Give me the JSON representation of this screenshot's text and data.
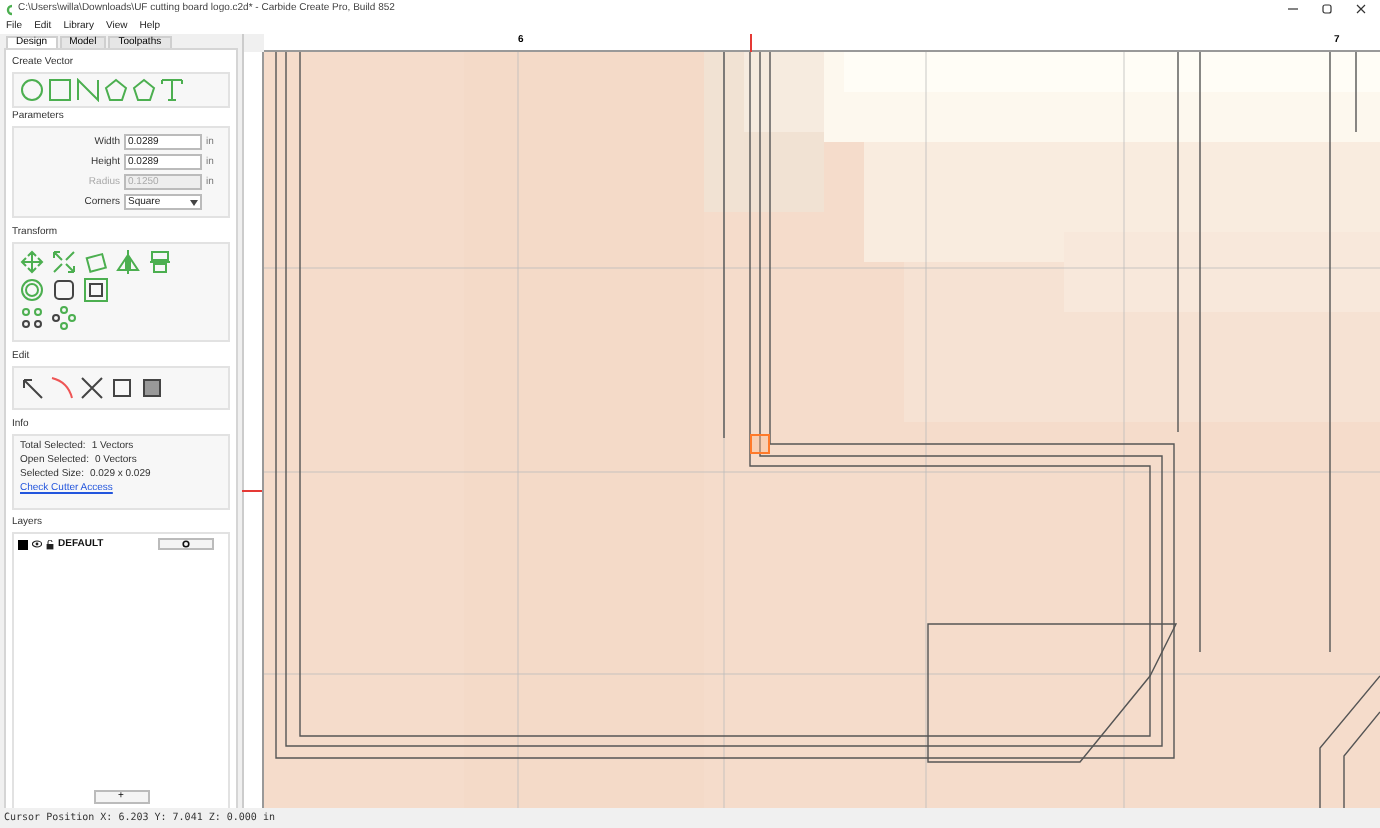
{
  "window": {
    "title": "C:\\Users\\willa\\Downloads\\UF cutting board logo.c2d* - Carbide Create Pro, Build 852"
  },
  "menu": [
    "File",
    "Edit",
    "Library",
    "View",
    "Help"
  ],
  "tabs": [
    {
      "label": "Design",
      "selected": true
    },
    {
      "label": "Model",
      "selected": false
    },
    {
      "label": "Toolpaths",
      "selected": false
    }
  ],
  "create_vector": {
    "title": "Create Vector"
  },
  "parameters": {
    "title": "Parameters",
    "fields": [
      {
        "label": "Width",
        "value": "0.0289",
        "unit": "in",
        "disabled": false
      },
      {
        "label": "Height",
        "value": "0.0289",
        "unit": "in",
        "disabled": false
      },
      {
        "label": "Radius",
        "value": "0.1250",
        "unit": "in",
        "disabled": true
      }
    ],
    "corner": {
      "label": "Corners",
      "value": "Square"
    }
  },
  "transform": {
    "title": "Transform"
  },
  "edit": {
    "title": "Edit"
  },
  "info": {
    "title": "Info",
    "rows": [
      {
        "label": "Total Selected:",
        "value": "1 Vectors"
      },
      {
        "label": "Open Selected:",
        "value": "0 Vectors"
      },
      {
        "label": "Selected Size:",
        "value": "0.029 x 0.029"
      }
    ],
    "link": "Check Cutter Access"
  },
  "layers": {
    "title": "Layers",
    "items": [
      {
        "name": "DEFAULT",
        "color": "#000000"
      }
    ],
    "add_button": "+"
  },
  "ruler": {
    "labels": [
      "6",
      "7"
    ]
  },
  "status_bar": "Cursor Position X: 6.203 Y: 7.041 Z: 0.000 in"
}
